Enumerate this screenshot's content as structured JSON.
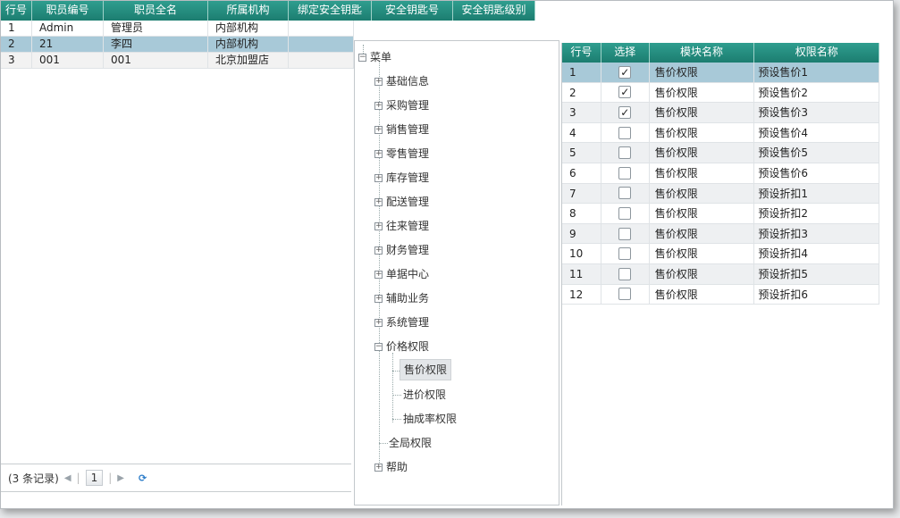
{
  "employee_grid": {
    "columns": [
      "行号",
      "职员编号",
      "职员全名",
      "所属机构",
      "绑定安全钥匙",
      "安全钥匙号",
      "安全钥匙级别"
    ],
    "rows": [
      {
        "no": "1",
        "code": "Admin",
        "name": "管理员",
        "org": "内部机构"
      },
      {
        "no": "2",
        "code": "21",
        "name": "李四",
        "org": "内部机构"
      },
      {
        "no": "3",
        "code": "001",
        "name": "001",
        "org": "北京加盟店"
      }
    ],
    "selected_row": 2
  },
  "pager": {
    "records": "(3 条记录)",
    "prev_icon": "◀",
    "page": "1",
    "next_icon": "▶",
    "refresh_icon": "refresh-icon"
  },
  "menu_tree": {
    "root": "菜单",
    "items": [
      {
        "label": "基础信息",
        "expanded": false
      },
      {
        "label": "采购管理",
        "expanded": false
      },
      {
        "label": "销售管理",
        "expanded": false
      },
      {
        "label": "零售管理",
        "expanded": false
      },
      {
        "label": "库存管理",
        "expanded": false
      },
      {
        "label": "配送管理",
        "expanded": false
      },
      {
        "label": "往来管理",
        "expanded": false
      },
      {
        "label": "财务管理",
        "expanded": false
      },
      {
        "label": "单据中心",
        "expanded": false
      },
      {
        "label": "辅助业务",
        "expanded": false
      },
      {
        "label": "系统管理",
        "expanded": false
      },
      {
        "label": "价格权限",
        "expanded": true
      }
    ],
    "price_children": [
      "售价权限",
      "进价权限",
      "抽成率权限"
    ],
    "global": "全局权限",
    "help": "帮助",
    "selected": "售价权限"
  },
  "permission_grid": {
    "columns": [
      "行号",
      "选择",
      "模块名称",
      "权限名称"
    ],
    "rows": [
      {
        "no": "1",
        "checked": true,
        "module": "售价权限",
        "perm": "预设售价1"
      },
      {
        "no": "2",
        "checked": true,
        "module": "售价权限",
        "perm": "预设售价2"
      },
      {
        "no": "3",
        "checked": true,
        "module": "售价权限",
        "perm": "预设售价3"
      },
      {
        "no": "4",
        "checked": false,
        "module": "售价权限",
        "perm": "预设售价4"
      },
      {
        "no": "5",
        "checked": false,
        "module": "售价权限",
        "perm": "预设售价5"
      },
      {
        "no": "6",
        "checked": false,
        "module": "售价权限",
        "perm": "预设售价6"
      },
      {
        "no": "7",
        "checked": false,
        "module": "售价权限",
        "perm": "预设折扣1"
      },
      {
        "no": "8",
        "checked": false,
        "module": "售价权限",
        "perm": "预设折扣2"
      },
      {
        "no": "9",
        "checked": false,
        "module": "售价权限",
        "perm": "预设折扣3"
      },
      {
        "no": "10",
        "checked": false,
        "module": "售价权限",
        "perm": "预设折扣4"
      },
      {
        "no": "11",
        "checked": false,
        "module": "售价权限",
        "perm": "预设折扣5"
      },
      {
        "no": "12",
        "checked": false,
        "module": "售价权限",
        "perm": "预设折扣6"
      }
    ],
    "selected_row": 1
  },
  "colors": {
    "header": "#1c7d70",
    "selected": "#a8c9d8"
  }
}
